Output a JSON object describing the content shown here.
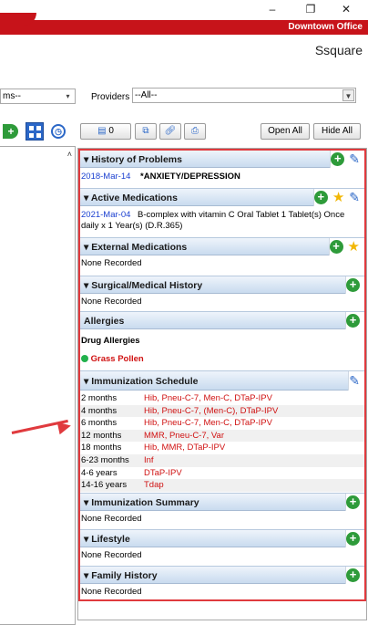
{
  "window": {
    "minimize_glyph": "–",
    "restore_glyph": "❐",
    "close_glyph": "✕",
    "office": "Downtown Office",
    "org": "Ssquare"
  },
  "filters": {
    "problems_value": "ms--",
    "providers_label": "Providers",
    "providers_value": "--All--"
  },
  "toolbar": {
    "count_label": "0",
    "open_all": "Open All",
    "hide_all": "Hide All"
  },
  "sections": {
    "history_of_problems": {
      "title": "History of Problems",
      "rows": [
        {
          "date": "2018-Mar-14",
          "text": "*ANXIETY/DEPRESSION"
        }
      ]
    },
    "active_medications": {
      "title": "Active Medications",
      "date": "2021-Mar-04",
      "text": "B-complex with vitamin C  Oral Tablet 1 Tablet(s) Once daily x 1 Year(s) (D.R.365)"
    },
    "external_medications": {
      "title": "External Medications",
      "empty": "None Recorded"
    },
    "surgical_history": {
      "title": "Surgical/Medical History",
      "empty": "None Recorded"
    },
    "allergies": {
      "title": "Allergies",
      "subheading": "Drug Allergies",
      "item": "Grass Pollen"
    },
    "immunization_schedule": {
      "title": "Immunization Schedule",
      "rows": [
        {
          "age": "2 months",
          "vaccines": "Hib, Pneu-C-7, Men-C, DTaP-IPV"
        },
        {
          "age": "4 months",
          "vaccines": "Hib, Pneu-C-7, (Men-C), DTaP-IPV"
        },
        {
          "age": "6 months",
          "vaccines": "Hib, Pneu-C-7, Men-C, DTaP-IPV"
        },
        {
          "age": "12 months",
          "vaccines": "MMR, Pneu-C-7, Var"
        },
        {
          "age": "18 months",
          "vaccines": "Hib, MMR, DTaP-IPV"
        },
        {
          "age": "6-23 months",
          "vaccines": "Inf"
        },
        {
          "age": "4-6 years",
          "vaccines": "DTaP-IPV"
        },
        {
          "age": "14-16 years",
          "vaccines": "Tdap"
        }
      ]
    },
    "immunization_summary": {
      "title": "Immunization Summary",
      "empty": "None Recorded"
    },
    "lifestyle": {
      "title": "Lifestyle",
      "empty": "None Recorded"
    },
    "family_history": {
      "title": "Family History",
      "empty": "None Recorded"
    }
  },
  "colors": {
    "brand_red": "#c7131a",
    "link_blue": "#1a3fd0",
    "vaccine_red": "#d01212",
    "add_green": "#2e9b3a",
    "highlight_red": "#e03a3e"
  }
}
